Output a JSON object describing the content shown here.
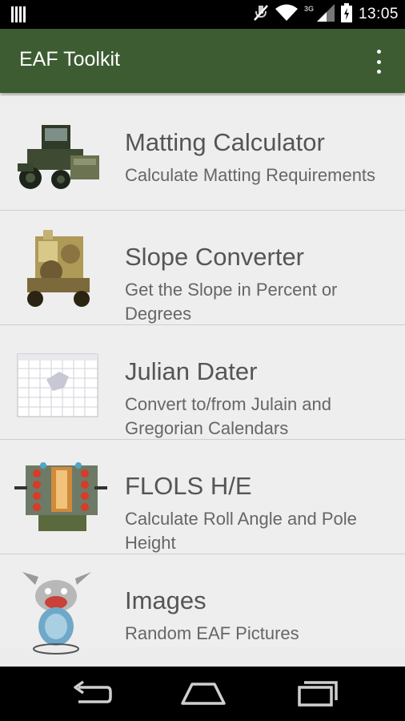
{
  "status_bar": {
    "time": "13:05",
    "network": "3G",
    "icons": [
      "notification-icon",
      "mute-icon",
      "wifi-icon",
      "signal-icon",
      "battery-icon"
    ]
  },
  "app_bar": {
    "title": "EAF Toolkit",
    "menu_icon": "overflow-menu-icon",
    "color": "#3d5c32"
  },
  "menu_items": [
    {
      "title": "Matting Calculator",
      "subtitle": "Calculate Matting Requirements",
      "icon": "loader-vehicle-image"
    },
    {
      "title": "Slope Converter",
      "subtitle": "Get the Slope in Percent or Degrees",
      "icon": "arresting-gear-image"
    },
    {
      "title": "Julian Dater",
      "subtitle": "Convert to/from Julain and Gregorian Calendars",
      "icon": "calendar-image"
    },
    {
      "title": "FLOLS H/E",
      "subtitle": "Calculate Roll Angle and Pole Height",
      "icon": "flols-lens-image"
    },
    {
      "title": "Images",
      "subtitle": "Random EAF Pictures",
      "icon": "cartoon-mascot-image"
    }
  ],
  "nav_bar": {
    "buttons": [
      "back-icon",
      "home-icon",
      "recent-apps-icon"
    ]
  }
}
